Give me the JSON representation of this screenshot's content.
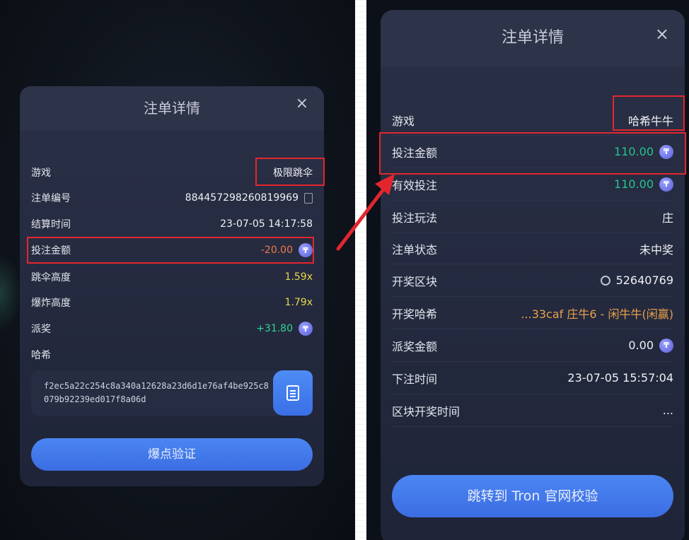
{
  "left": {
    "title": "注单详情",
    "close_label": "×",
    "rows": [
      {
        "label": "游戏",
        "value": "极限跳伞"
      },
      {
        "label": "注单编号",
        "value": "884457298260819969"
      },
      {
        "label": "结算时间",
        "value": "23-07-05 14:17:58"
      },
      {
        "label": "投注金额",
        "value": "-20.00"
      },
      {
        "label": "跳伞高度",
        "value": "1.59x"
      },
      {
        "label": "爆炸高度",
        "value": "1.79x"
      },
      {
        "label": "派奖",
        "value": "+31.80"
      },
      {
        "label": "哈希",
        "value": ""
      }
    ],
    "hash": "f2ec5a22c254c8a340a12628a23d6d1e76af4be925c8079b92239ed017f8a06d",
    "verify_label": "爆点验证"
  },
  "right": {
    "title": "注单详情",
    "close_label": "×",
    "rows": [
      {
        "label": "游戏",
        "value": "哈希牛牛"
      },
      {
        "label": "投注金额",
        "value": "110.00"
      },
      {
        "label": "有效投注",
        "value": "110.00"
      },
      {
        "label": "投注玩法",
        "value": "庄"
      },
      {
        "label": "注单状态",
        "value": "未中奖"
      },
      {
        "label": "开奖区块",
        "value": "52640769"
      },
      {
        "label": "开奖哈希",
        "value": "...33caf 庄牛6 - 闲牛牛(闲赢)"
      },
      {
        "label": "派奖金额",
        "value": "0.00"
      },
      {
        "label": "下注时间",
        "value": "23-07-05 15:57:04"
      },
      {
        "label": "区块开奖时间",
        "value": "..."
      }
    ],
    "verify_label": "跳转到 Tron 官网校验"
  },
  "colors": {
    "accent_blue": "#4b86f3",
    "highlight_red": "#e3262e",
    "negative": "#f07a4a",
    "positive": "#2fd68f",
    "multiplier": "#e8d84a",
    "hash_result": "#e8a24a"
  },
  "icons": {
    "coin": "tron-coin-icon",
    "copy": "copy-icon",
    "close": "close-icon",
    "block": "block-icon",
    "arrow": "red-arrow-annotation"
  },
  "coin_glyph": "₸"
}
